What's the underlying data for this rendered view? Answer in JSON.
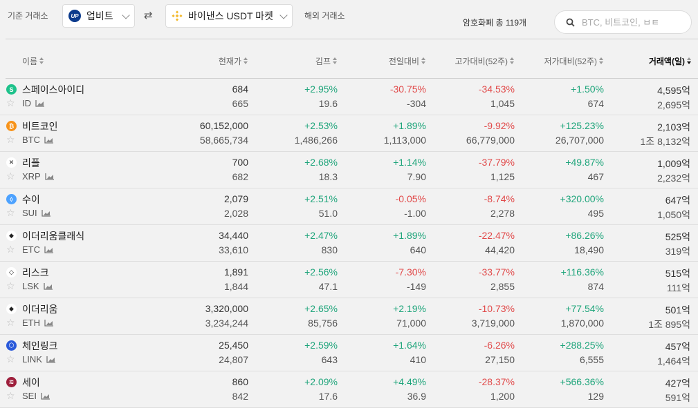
{
  "topbar": {
    "base_exchange_label": "기준 거래소",
    "base_exchange_value": "업비트",
    "foreign_exchange_value": "바이낸스 USDT 마켓",
    "foreign_exchange_label": "해외 거래소",
    "coin_count": "암호화폐 총 119개",
    "search_placeholder": "BTC, 비트코인, ㅂㅌ"
  },
  "columns": {
    "name": "이름",
    "price": "현재가",
    "kimp": "김프",
    "change": "전일대비",
    "high52": "고가대비(52주)",
    "low52": "저가대비(52주)",
    "volume": "거래액(일)"
  },
  "coins": [
    {
      "name": "스페이스아이디",
      "symbol": "ID",
      "icon": "space-id-icon",
      "icon_color": "#1ec28b",
      "icon_glyph": "S",
      "price": "684",
      "price2": "665",
      "kimp": "+2.95%",
      "kimp2": "19.6",
      "change": "-30.75%",
      "change2": "-304",
      "change_dir": "down",
      "high": "-34.53%",
      "high2": "1,045",
      "low": "+1.50%",
      "low2": "674",
      "vol": "4,595억",
      "vol2": "2,695억"
    },
    {
      "name": "비트코인",
      "symbol": "BTC",
      "icon": "bitcoin-icon",
      "icon_color": "#f7931a",
      "icon_glyph": "₿",
      "price": "60,152,000",
      "price2": "58,665,734",
      "kimp": "+2.53%",
      "kimp2": "1,486,266",
      "change": "+1.89%",
      "change2": "1,113,000",
      "change_dir": "up",
      "high": "-9.92%",
      "high2": "66,779,000",
      "low": "+125.23%",
      "low2": "26,707,000",
      "vol": "2,103억",
      "vol2": "1조 8,132억"
    },
    {
      "name": "리플",
      "symbol": "XRP",
      "icon": "ripple-icon",
      "icon_color": "#ffffff",
      "icon_glyph": "✕",
      "price": "700",
      "price2": "682",
      "kimp": "+2.68%",
      "kimp2": "18.3",
      "change": "+1.14%",
      "change2": "7.90",
      "change_dir": "up",
      "high": "-37.79%",
      "high2": "1,125",
      "low": "+49.87%",
      "low2": "467",
      "vol": "1,009억",
      "vol2": "2,232억"
    },
    {
      "name": "수이",
      "symbol": "SUI",
      "icon": "sui-icon",
      "icon_color": "#4da2ff",
      "icon_glyph": "◊",
      "price": "2,079",
      "price2": "2,028",
      "kimp": "+2.51%",
      "kimp2": "51.0",
      "change": "-0.05%",
      "change2": "-1.00",
      "change_dir": "down",
      "high": "-8.74%",
      "high2": "2,278",
      "low": "+320.00%",
      "low2": "495",
      "vol": "647억",
      "vol2": "1,050억"
    },
    {
      "name": "이더리움클래식",
      "symbol": "ETC",
      "icon": "ethereum-classic-icon",
      "icon_color": "#ffffff",
      "icon_glyph": "◆",
      "price": "34,440",
      "price2": "33,610",
      "kimp": "+2.47%",
      "kimp2": "830",
      "change": "+1.89%",
      "change2": "640",
      "change_dir": "up",
      "high": "-22.47%",
      "high2": "44,420",
      "low": "+86.26%",
      "low2": "18,490",
      "vol": "525억",
      "vol2": "319억"
    },
    {
      "name": "리스크",
      "symbol": "LSK",
      "icon": "lisk-icon",
      "icon_color": "#ffffff",
      "icon_glyph": "◇",
      "price": "1,891",
      "price2": "1,844",
      "kimp": "+2.56%",
      "kimp2": "47.1",
      "change": "-7.30%",
      "change2": "-149",
      "change_dir": "down",
      "high": "-33.77%",
      "high2": "2,855",
      "low": "+116.36%",
      "low2": "874",
      "vol": "515억",
      "vol2": "111억"
    },
    {
      "name": "이더리움",
      "symbol": "ETH",
      "icon": "ethereum-icon",
      "icon_color": "#ffffff",
      "icon_glyph": "◆",
      "price": "3,320,000",
      "price2": "3,234,244",
      "kimp": "+2.65%",
      "kimp2": "85,756",
      "change": "+2.19%",
      "change2": "71,000",
      "change_dir": "up",
      "high": "-10.73%",
      "high2": "3,719,000",
      "low": "+77.54%",
      "low2": "1,870,000",
      "vol": "501억",
      "vol2": "1조 895억"
    },
    {
      "name": "체인링크",
      "symbol": "LINK",
      "icon": "chainlink-icon",
      "icon_color": "#2a5ada",
      "icon_glyph": "⬡",
      "price": "25,450",
      "price2": "24,807",
      "kimp": "+2.59%",
      "kimp2": "643",
      "change": "+1.64%",
      "change2": "410",
      "change_dir": "up",
      "high": "-6.26%",
      "high2": "27,150",
      "low": "+288.25%",
      "low2": "6,555",
      "vol": "457억",
      "vol2": "1,464억"
    },
    {
      "name": "세이",
      "symbol": "SEI",
      "icon": "sei-icon",
      "icon_color": "#9e1f3c",
      "icon_glyph": "≋",
      "price": "860",
      "price2": "842",
      "kimp": "+2.09%",
      "kimp2": "17.6",
      "change": "+4.49%",
      "change2": "36.9",
      "change_dir": "up",
      "high": "-28.37%",
      "high2": "1,200",
      "low": "+566.36%",
      "low2": "129",
      "vol": "427억",
      "vol2": "591억"
    }
  ]
}
